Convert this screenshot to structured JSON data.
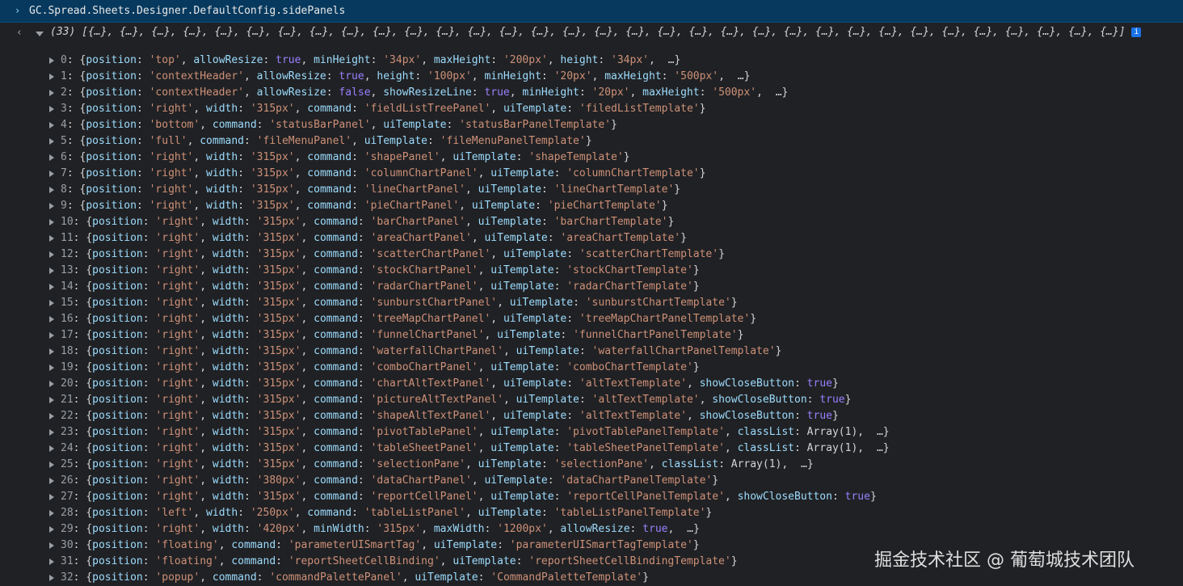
{
  "console": {
    "expression": "GC.Spread.Sheets.Designer.DefaultConfig.sidePanels",
    "result_summary": "(33) [{…}, {…}, {…}, {…}, {…}, {…}, {…}, {…}, {…}, {…}, {…}, {…}, {…}, {…}, {…}, {…}, {…}, {…}, {…}, {…}, {…}, {…}, {…}, {…}, {…}, {…}, {…}, {…}, {…}, {…}, {…}, {…}, {…}]",
    "info_badge": "i",
    "return_arrow": "‹",
    "prompt_chevron": "›"
  },
  "rows": [
    {
      "index": "0",
      "props": [
        [
          "position",
          "'top'",
          "s"
        ],
        [
          "allowResize",
          "true",
          "b"
        ],
        [
          "minHeight",
          "'34px'",
          "s"
        ],
        [
          "maxHeight",
          "'200px'",
          "s"
        ],
        [
          "height",
          "'34px'",
          "s"
        ]
      ],
      "ellipsis": true
    },
    {
      "index": "1",
      "props": [
        [
          "position",
          "'contextHeader'",
          "s"
        ],
        [
          "allowResize",
          "true",
          "b"
        ],
        [
          "height",
          "'100px'",
          "s"
        ],
        [
          "minHeight",
          "'20px'",
          "s"
        ],
        [
          "maxHeight",
          "'500px'",
          "s"
        ]
      ],
      "ellipsis": true
    },
    {
      "index": "2",
      "props": [
        [
          "position",
          "'contextHeader'",
          "s"
        ],
        [
          "allowResize",
          "false",
          "b"
        ],
        [
          "showResizeLine",
          "true",
          "b"
        ],
        [
          "minHeight",
          "'20px'",
          "s"
        ],
        [
          "maxHeight",
          "'500px'",
          "s"
        ]
      ],
      "ellipsis": true
    },
    {
      "index": "3",
      "props": [
        [
          "position",
          "'right'",
          "s"
        ],
        [
          "width",
          "'315px'",
          "s"
        ],
        [
          "command",
          "'fieldListTreePanel'",
          "s"
        ],
        [
          "uiTemplate",
          "'filedListTemplate'",
          "s"
        ]
      ],
      "ellipsis": false
    },
    {
      "index": "4",
      "props": [
        [
          "position",
          "'bottom'",
          "s"
        ],
        [
          "command",
          "'statusBarPanel'",
          "s"
        ],
        [
          "uiTemplate",
          "'statusBarPanelTemplate'",
          "s"
        ]
      ],
      "ellipsis": false
    },
    {
      "index": "5",
      "props": [
        [
          "position",
          "'full'",
          "s"
        ],
        [
          "command",
          "'fileMenuPanel'",
          "s"
        ],
        [
          "uiTemplate",
          "'fileMenuPanelTemplate'",
          "s"
        ]
      ],
      "ellipsis": false
    },
    {
      "index": "6",
      "props": [
        [
          "position",
          "'right'",
          "s"
        ],
        [
          "width",
          "'315px'",
          "s"
        ],
        [
          "command",
          "'shapePanel'",
          "s"
        ],
        [
          "uiTemplate",
          "'shapeTemplate'",
          "s"
        ]
      ],
      "ellipsis": false
    },
    {
      "index": "7",
      "props": [
        [
          "position",
          "'right'",
          "s"
        ],
        [
          "width",
          "'315px'",
          "s"
        ],
        [
          "command",
          "'columnChartPanel'",
          "s"
        ],
        [
          "uiTemplate",
          "'columnChartTemplate'",
          "s"
        ]
      ],
      "ellipsis": false
    },
    {
      "index": "8",
      "props": [
        [
          "position",
          "'right'",
          "s"
        ],
        [
          "width",
          "'315px'",
          "s"
        ],
        [
          "command",
          "'lineChartPanel'",
          "s"
        ],
        [
          "uiTemplate",
          "'lineChartTemplate'",
          "s"
        ]
      ],
      "ellipsis": false
    },
    {
      "index": "9",
      "props": [
        [
          "position",
          "'right'",
          "s"
        ],
        [
          "width",
          "'315px'",
          "s"
        ],
        [
          "command",
          "'pieChartPanel'",
          "s"
        ],
        [
          "uiTemplate",
          "'pieChartTemplate'",
          "s"
        ]
      ],
      "ellipsis": false
    },
    {
      "index": "10",
      "props": [
        [
          "position",
          "'right'",
          "s"
        ],
        [
          "width",
          "'315px'",
          "s"
        ],
        [
          "command",
          "'barChartPanel'",
          "s"
        ],
        [
          "uiTemplate",
          "'barChartTemplate'",
          "s"
        ]
      ],
      "ellipsis": false
    },
    {
      "index": "11",
      "props": [
        [
          "position",
          "'right'",
          "s"
        ],
        [
          "width",
          "'315px'",
          "s"
        ],
        [
          "command",
          "'areaChartPanel'",
          "s"
        ],
        [
          "uiTemplate",
          "'areaChartTemplate'",
          "s"
        ]
      ],
      "ellipsis": false
    },
    {
      "index": "12",
      "props": [
        [
          "position",
          "'right'",
          "s"
        ],
        [
          "width",
          "'315px'",
          "s"
        ],
        [
          "command",
          "'scatterChartPanel'",
          "s"
        ],
        [
          "uiTemplate",
          "'scatterChartTemplate'",
          "s"
        ]
      ],
      "ellipsis": false
    },
    {
      "index": "13",
      "props": [
        [
          "position",
          "'right'",
          "s"
        ],
        [
          "width",
          "'315px'",
          "s"
        ],
        [
          "command",
          "'stockChartPanel'",
          "s"
        ],
        [
          "uiTemplate",
          "'stockChartTemplate'",
          "s"
        ]
      ],
      "ellipsis": false
    },
    {
      "index": "14",
      "props": [
        [
          "position",
          "'right'",
          "s"
        ],
        [
          "width",
          "'315px'",
          "s"
        ],
        [
          "command",
          "'radarChartPanel'",
          "s"
        ],
        [
          "uiTemplate",
          "'radarChartTemplate'",
          "s"
        ]
      ],
      "ellipsis": false
    },
    {
      "index": "15",
      "props": [
        [
          "position",
          "'right'",
          "s"
        ],
        [
          "width",
          "'315px'",
          "s"
        ],
        [
          "command",
          "'sunburstChartPanel'",
          "s"
        ],
        [
          "uiTemplate",
          "'sunburstChartTemplate'",
          "s"
        ]
      ],
      "ellipsis": false
    },
    {
      "index": "16",
      "props": [
        [
          "position",
          "'right'",
          "s"
        ],
        [
          "width",
          "'315px'",
          "s"
        ],
        [
          "command",
          "'treeMapChartPanel'",
          "s"
        ],
        [
          "uiTemplate",
          "'treeMapChartPanelTemplate'",
          "s"
        ]
      ],
      "ellipsis": false
    },
    {
      "index": "17",
      "props": [
        [
          "position",
          "'right'",
          "s"
        ],
        [
          "width",
          "'315px'",
          "s"
        ],
        [
          "command",
          "'funnelChartPanel'",
          "s"
        ],
        [
          "uiTemplate",
          "'funnelChartPanelTemplate'",
          "s"
        ]
      ],
      "ellipsis": false
    },
    {
      "index": "18",
      "props": [
        [
          "position",
          "'right'",
          "s"
        ],
        [
          "width",
          "'315px'",
          "s"
        ],
        [
          "command",
          "'waterfallChartPanel'",
          "s"
        ],
        [
          "uiTemplate",
          "'waterfallChartPanelTemplate'",
          "s"
        ]
      ],
      "ellipsis": false
    },
    {
      "index": "19",
      "props": [
        [
          "position",
          "'right'",
          "s"
        ],
        [
          "width",
          "'315px'",
          "s"
        ],
        [
          "command",
          "'comboChartPanel'",
          "s"
        ],
        [
          "uiTemplate",
          "'comboChartTemplate'",
          "s"
        ]
      ],
      "ellipsis": false
    },
    {
      "index": "20",
      "props": [
        [
          "position",
          "'right'",
          "s"
        ],
        [
          "width",
          "'315px'",
          "s"
        ],
        [
          "command",
          "'chartAltTextPanel'",
          "s"
        ],
        [
          "uiTemplate",
          "'altTextTemplate'",
          "s"
        ],
        [
          "showCloseButton",
          "true",
          "b"
        ]
      ],
      "ellipsis": false
    },
    {
      "index": "21",
      "props": [
        [
          "position",
          "'right'",
          "s"
        ],
        [
          "width",
          "'315px'",
          "s"
        ],
        [
          "command",
          "'pictureAltTextPanel'",
          "s"
        ],
        [
          "uiTemplate",
          "'altTextTemplate'",
          "s"
        ],
        [
          "showCloseButton",
          "true",
          "b"
        ]
      ],
      "ellipsis": false
    },
    {
      "index": "22",
      "props": [
        [
          "position",
          "'right'",
          "s"
        ],
        [
          "width",
          "'315px'",
          "s"
        ],
        [
          "command",
          "'shapeAltTextPanel'",
          "s"
        ],
        [
          "uiTemplate",
          "'altTextTemplate'",
          "s"
        ],
        [
          "showCloseButton",
          "true",
          "b"
        ]
      ],
      "ellipsis": false
    },
    {
      "index": "23",
      "props": [
        [
          "position",
          "'right'",
          "s"
        ],
        [
          "width",
          "'315px'",
          "s"
        ],
        [
          "command",
          "'pivotTablePanel'",
          "s"
        ],
        [
          "uiTemplate",
          "'pivotTablePanelTemplate'",
          "s"
        ],
        [
          "classList",
          "Array(1)",
          "p"
        ]
      ],
      "ellipsis": true
    },
    {
      "index": "24",
      "props": [
        [
          "position",
          "'right'",
          "s"
        ],
        [
          "width",
          "'315px'",
          "s"
        ],
        [
          "command",
          "'tableSheetPanel'",
          "s"
        ],
        [
          "uiTemplate",
          "'tableSheetPanelTemplate'",
          "s"
        ],
        [
          "classList",
          "Array(1)",
          "p"
        ]
      ],
      "ellipsis": true
    },
    {
      "index": "25",
      "props": [
        [
          "position",
          "'right'",
          "s"
        ],
        [
          "width",
          "'315px'",
          "s"
        ],
        [
          "command",
          "'selectionPane'",
          "s"
        ],
        [
          "uiTemplate",
          "'selectionPane'",
          "s"
        ],
        [
          "classList",
          "Array(1)",
          "p"
        ]
      ],
      "ellipsis": true
    },
    {
      "index": "26",
      "props": [
        [
          "position",
          "'right'",
          "s"
        ],
        [
          "width",
          "'380px'",
          "s"
        ],
        [
          "command",
          "'dataChartPanel'",
          "s"
        ],
        [
          "uiTemplate",
          "'dataChartPanelTemplate'",
          "s"
        ]
      ],
      "ellipsis": false
    },
    {
      "index": "27",
      "props": [
        [
          "position",
          "'right'",
          "s"
        ],
        [
          "width",
          "'315px'",
          "s"
        ],
        [
          "command",
          "'reportCellPanel'",
          "s"
        ],
        [
          "uiTemplate",
          "'reportCellPanelTemplate'",
          "s"
        ],
        [
          "showCloseButton",
          "true",
          "b"
        ]
      ],
      "ellipsis": false
    },
    {
      "index": "28",
      "props": [
        [
          "position",
          "'left'",
          "s"
        ],
        [
          "width",
          "'250px'",
          "s"
        ],
        [
          "command",
          "'tableListPanel'",
          "s"
        ],
        [
          "uiTemplate",
          "'tableListPanelTemplate'",
          "s"
        ]
      ],
      "ellipsis": false
    },
    {
      "index": "29",
      "props": [
        [
          "position",
          "'right'",
          "s"
        ],
        [
          "width",
          "'420px'",
          "s"
        ],
        [
          "minWidth",
          "'315px'",
          "s"
        ],
        [
          "maxWidth",
          "'1200px'",
          "s"
        ],
        [
          "allowResize",
          "true",
          "b"
        ]
      ],
      "ellipsis": true
    },
    {
      "index": "30",
      "props": [
        [
          "position",
          "'floating'",
          "s"
        ],
        [
          "command",
          "'parameterUISmartTag'",
          "s"
        ],
        [
          "uiTemplate",
          "'parameterUISmartTagTemplate'",
          "s"
        ]
      ],
      "ellipsis": false
    },
    {
      "index": "31",
      "props": [
        [
          "position",
          "'floating'",
          "s"
        ],
        [
          "command",
          "'reportSheetCellBinding'",
          "s"
        ],
        [
          "uiTemplate",
          "'reportSheetCellBindingTemplate'",
          "s"
        ]
      ],
      "ellipsis": false
    },
    {
      "index": "32",
      "props": [
        [
          "position",
          "'popup'",
          "s"
        ],
        [
          "command",
          "'commandPalettePanel'",
          "s"
        ],
        [
          "uiTemplate",
          "'CommandPaletteTemplate'",
          "s"
        ]
      ],
      "ellipsis": false
    }
  ],
  "watermark": "掘金技术社区 @ 葡萄城技术团队",
  "colors": {
    "key": "#9cdcfe",
    "string": "#ce9178",
    "boolean": "#9980ff",
    "background": "#202124",
    "input_bar": "#07395e"
  }
}
